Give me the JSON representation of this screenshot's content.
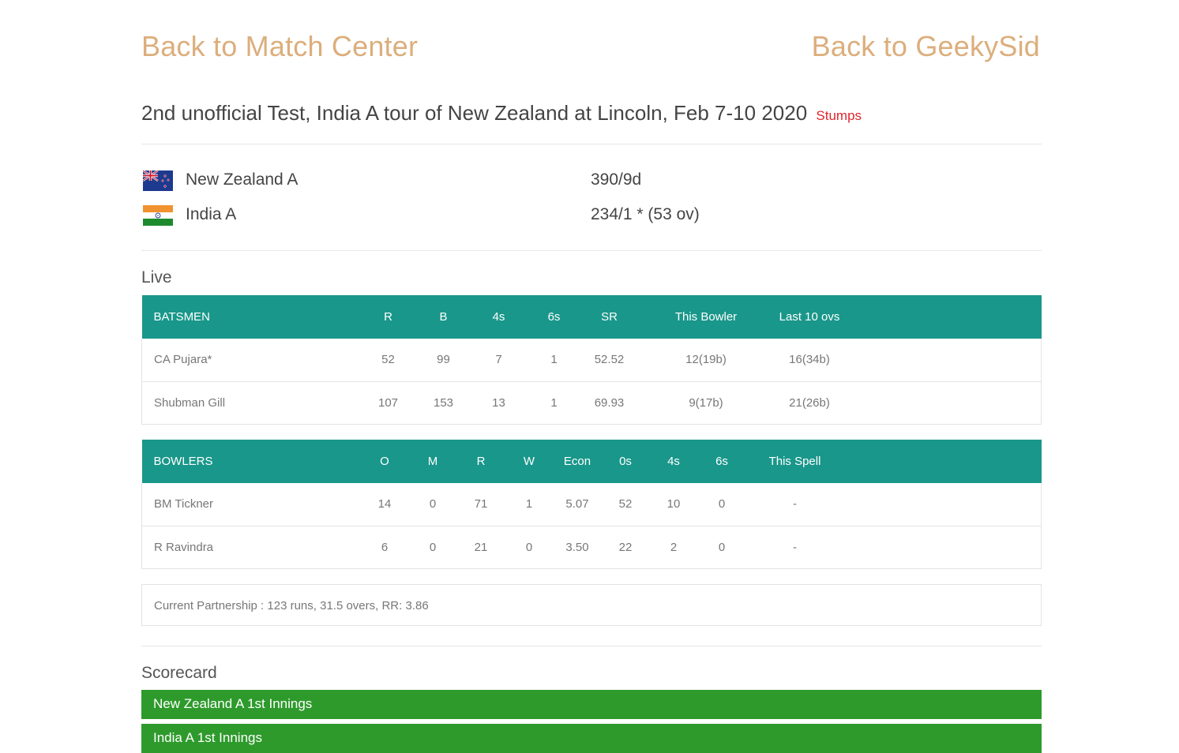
{
  "nav": {
    "back_match_center": "Back to Match Center",
    "back_geekysid": "Back to GeekySid"
  },
  "match": {
    "title": "2nd unofficial Test, India A tour of New Zealand at Lincoln, Feb 7-10 2020",
    "status": "Stumps"
  },
  "teams": [
    {
      "name": "New Zealand A",
      "score": "390/9d",
      "flag": "new-zealand-flag"
    },
    {
      "name": "India A",
      "score": "234/1 * (53 ov)",
      "flag": "india-flag"
    }
  ],
  "live": {
    "heading": "Live",
    "batsmen": {
      "headers": [
        "BATSMEN",
        "R",
        "B",
        "4s",
        "6s",
        "SR",
        "This Bowler",
        "Last 10 ovs"
      ],
      "rows": [
        [
          "CA Pujara*",
          "52",
          "99",
          "7",
          "1",
          "52.52",
          "12(19b)",
          "16(34b)"
        ],
        [
          "Shubman Gill",
          "107",
          "153",
          "13",
          "1",
          "69.93",
          "9(17b)",
          "21(26b)"
        ]
      ]
    },
    "bowlers": {
      "headers": [
        "BOWLERS",
        "O",
        "M",
        "R",
        "W",
        "Econ",
        "0s",
        "4s",
        "6s",
        "This Spell"
      ],
      "rows": [
        [
          "BM Tickner",
          "14",
          "0",
          "71",
          "1",
          "5.07",
          "52",
          "10",
          "0",
          "-"
        ],
        [
          "R Ravindra",
          "6",
          "0",
          "21",
          "0",
          "3.50",
          "22",
          "2",
          "0",
          "-"
        ]
      ]
    },
    "partnership": "Current Partnership : 123 runs, 31.5 overs, RR: 3.86"
  },
  "scorecard": {
    "heading": "Scorecard",
    "innings": [
      "New Zealand A 1st Innings",
      "India A 1st Innings"
    ]
  },
  "colors": {
    "link": "#dcae7c",
    "status": "#e0262b",
    "table_header": "#19978a",
    "innings_bar": "#2e9a2c"
  }
}
